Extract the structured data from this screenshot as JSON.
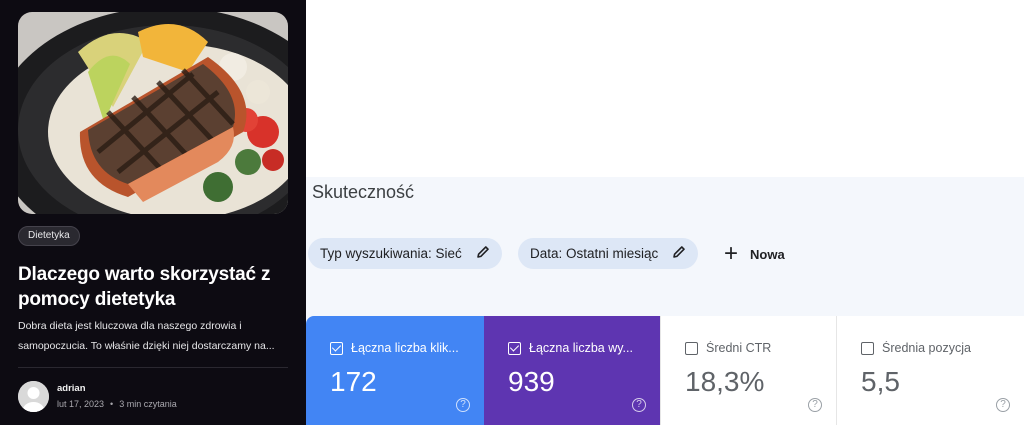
{
  "blog_card": {
    "category": "Dietetyka",
    "title": "Dlaczego warto skorzystać z pomocy dietetyka",
    "excerpt": "Dobra dieta jest kluczowa dla naszego zdrowia i samopoczucia. To właśnie dzięki niej dostarczamy na...",
    "author": "adrian",
    "date": "lut 17, 2023",
    "separator": "•",
    "read_time": "3 min czytania"
  },
  "performance": {
    "title": "Skuteczność",
    "filters": [
      {
        "label": "Typ wyszukiwania: Sieć",
        "icon": "pencil-icon"
      },
      {
        "label": "Data: Ostatni miesiąc",
        "icon": "pencil-icon"
      }
    ],
    "add_new": {
      "icon": "plus-icon",
      "label": "Nowa"
    },
    "metrics": [
      {
        "label": "Łączna liczba klik...",
        "value": "172",
        "checked": true,
        "color": "#4285f4"
      },
      {
        "label": "Łączna liczba wy...",
        "value": "939",
        "checked": true,
        "color": "#5e35b1"
      },
      {
        "label": "Średni CTR",
        "value": "18,3%",
        "checked": false,
        "color": "#ffffff"
      },
      {
        "label": "Średnia pozycja",
        "value": "5,5",
        "checked": false,
        "color": "#ffffff"
      }
    ],
    "help_symbol": "?"
  }
}
